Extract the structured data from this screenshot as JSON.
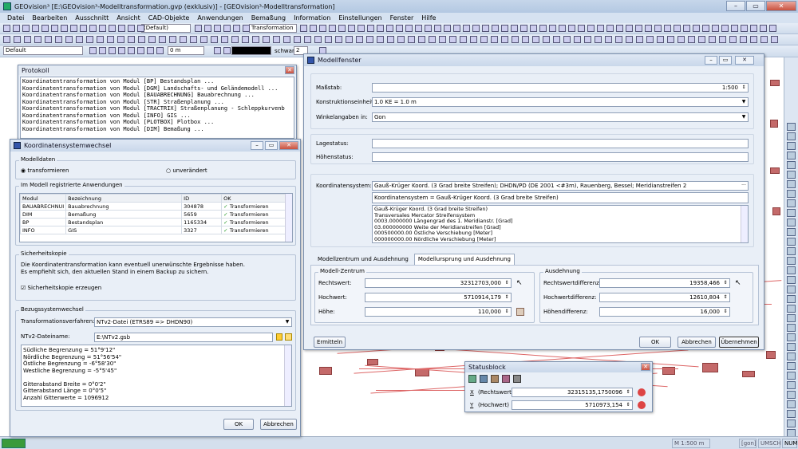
{
  "app": {
    "title": "GEOvision³  [E:\\GEOvision³-Modelltransformation.gvp (exklusiv)] - [GEOvision³-Modelltransformation]"
  },
  "menu": [
    "Datei",
    "Bearbeiten",
    "Ausschnitt",
    "Ansicht",
    "CAD-Objekte",
    "Anwendungen",
    "Bemaßung",
    "Information",
    "Einstellungen",
    "Fenster",
    "Hilfe"
  ],
  "toolbar": {
    "preset": "(Default)",
    "transformation": "Transformation",
    "layer": "Default",
    "width": "0 m",
    "color": "schwarz",
    "number": "2"
  },
  "protokoll": {
    "title": "Protokoll",
    "lines": [
      "Koordinatentransformation von Modul [BP] Bestandsplan ...",
      "Koordinatentransformation von Modul [DGM] Landschafts- und Geländemodell ...",
      "Koordinatentransformation von Modul [BAUABRECHNUNG] Bauabrechnung ...",
      "Koordinatentransformation von Modul [STR] Straßenplanung ...",
      "Koordinatentransformation von Modul [TRACTRIX] Straßenplanung - Schleppkurvenb",
      "Koordinatentransformation von Modul [INFO] GIS ...",
      "Koordinatentransformation von Modul [PLOTBOX] Plotbox ...",
      "Koordinatentransformation von Modul [DIM] Bemaßung ..."
    ]
  },
  "kw": {
    "title": "Koordinatensystemwechsel",
    "modelldaten": "Modelldaten",
    "transformieren": "transformieren",
    "unveraendert": "unverändert",
    "anwendungen_title": "Im Modell registrierte Anwendungen",
    "columns": [
      "Modul",
      "Bezeichnung",
      "ID",
      "OK"
    ],
    "rows": [
      [
        "BAUABRECHNUI",
        "Bauabrechnung",
        "304878",
        "Transformieren"
      ],
      [
        "DIM",
        "Bemaßung",
        "5659",
        "Transformieren"
      ],
      [
        "BP",
        "Bestandsplan",
        "1165334",
        "Transformieren"
      ],
      [
        "INFO",
        "GIS",
        "3327",
        "Transformieren"
      ]
    ],
    "sicherheit_title": "Sicherheitskopie",
    "sicherheit_text1": "Die Koordinatentransformation kann eventuell unerwünschte Ergebnisse haben.",
    "sicherheit_text2": "Es empfiehlt sich, den aktuellen Stand in einem Backup zu sichern.",
    "sicherheit_check": "Sicherheitskopie erzeugen",
    "bezug_title": "Bezugssystemwechsel",
    "verfahren_label": "Transformationsverfahren:",
    "verfahren_value": "NTv2-Datei (ETRS89 => DHDN90)",
    "datei_label": "NTv2-Dateiname:",
    "datei_value": "E:\\NTv2.gsb",
    "info_lines": [
      "Südliche Begrenzung = 51°9'12\"",
      "Nördliche Begrenzung = 51°56'54\"",
      "Östliche Begrenzung = -6°58'30\"",
      "Westliche Begrenzung = -5°5'45\"",
      "",
      "Gitterabstand Breite = 0°0'2\"",
      "Gitterabstand Länge = 0°0'5\"",
      "Anzahl Gitterwerte = 1096912"
    ],
    "ok": "OK",
    "abbrechen": "Abbrechen"
  },
  "mf": {
    "title": "Modellfenster",
    "massstab_label": "Maßstab:",
    "massstab_value": "1:500",
    "einheit_label": "Konstruktionseinheit:",
    "einheit_value": "1.0 KE  =  1.0 m",
    "winkel_label": "Winkelangaben in:",
    "winkel_value": "Gon",
    "lage_label": "Lagestatus:",
    "hoehe_label": "Höhenstatus:",
    "ks_label": "Koordinatensystem:",
    "ks_value": "Gauß-Krüger Koord. (3 Grad breite Streifen); DHDN/PD (DE 2001 <#3m), Rauenberg, Bessel; Meridianstreifen 2",
    "ks_select": "Koordinatensystem = Gauß-Krüger Koord. (3 Grad breite Streifen)",
    "ks_lines": [
      "Gauß-Krüger Koord. (3 Grad breite Streifen)",
      "Transversales Mercator Streifensystem",
      "0003.0000000 Längengrad des 1. Meridianstr. [Grad]",
      "03.000000000 Weite der Meridianstreifen [Grad]",
      "000500000.00 Östliche Verschiebung [Meter]",
      "000000000.00 Nördliche Verschiebung [Meter]"
    ],
    "tabs": [
      "Modellzentrum und Ausdehnung",
      "Modellursprung und Ausdehnung"
    ],
    "zentrum_title": "Modell-Zentrum",
    "rechtswert_label": "Rechtswert:",
    "rechtswert": "32312703,000",
    "hochwert_label": "Hochwert:",
    "hochwert": "5710914,179",
    "hoehe2_label": "Höhe:",
    "hoehe2": "110,000",
    "ausdehnung_title": "Ausdehnung",
    "rdiff_label": "Rechtswertdifferenz:",
    "rdiff": "19358,466",
    "hdiff_label": "Hochwertdifferenz:",
    "hdiff": "12610,804",
    "hoehendiff_label": "Höhendifferenz:",
    "hoehendiff": "16,000",
    "ermitteln": "Ermitteln",
    "ok": "OK",
    "abbrechen": "Abbrechen",
    "uebernehmen": "Übernehmen"
  },
  "sb": {
    "title": "Statusblock",
    "r_label": "(Rechtswert)",
    "r_value": "32315135,1750096",
    "h_label": "(Hochwert)",
    "h_value": "5710973,154",
    "r_key": "X",
    "h_key": "Y"
  },
  "status": {
    "scale": "M 1:500 m",
    "gon": "[gon]",
    "umsch": "UMSCH",
    "num": "NUM"
  },
  "colors": {
    "accent": "#2a62b8",
    "map_building": "#c46a6a"
  }
}
